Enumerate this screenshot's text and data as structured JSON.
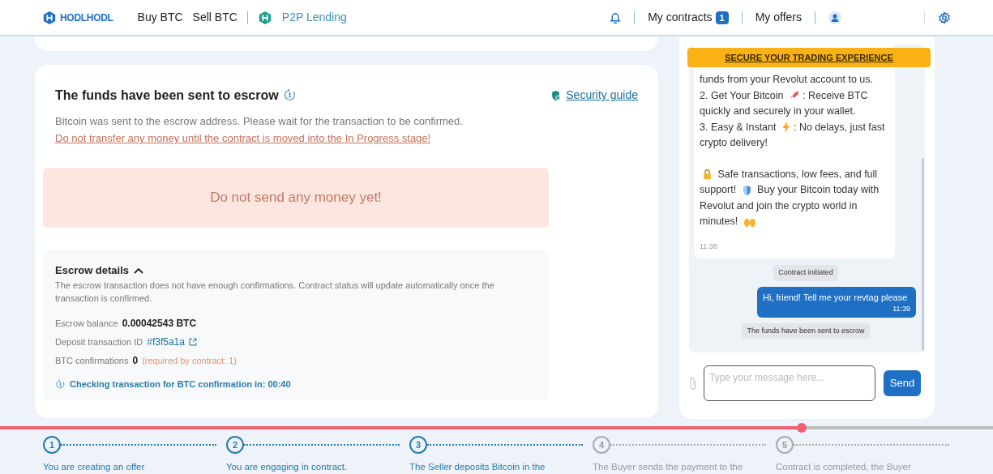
{
  "header": {
    "logo": "HODLHODL",
    "nav": [
      {
        "label": "Buy BTC"
      },
      {
        "label": "Sell BTC"
      }
    ],
    "lending": "P2P Lending",
    "contracts": {
      "label": "My contracts",
      "count": "1"
    },
    "offers": "My offers"
  },
  "status": {
    "title": "The funds have been sent to escrow",
    "guide": "Security guide",
    "text": "Bitcoin was sent to the escrow address. Please wait for the transaction to be confirmed.",
    "warning": "Do not transfer any money until the contract is moved into the In Progress stage!",
    "alert": "Do not send any money yet!"
  },
  "escrow": {
    "title": "Escrow details",
    "expanded": true,
    "note": "The escrow transaction does not have enough confirmations. Contract status will update automatically once the transaction is confirmed.",
    "balance": {
      "label": "Escrow balance",
      "value": "0.00042543 BTC"
    },
    "deposit": {
      "label": "Deposit transaction ID",
      "value": "#f3f5a1a"
    },
    "confirmations": {
      "label": "BTC confirmations",
      "value": "0",
      "required": "(required by contract: 1)"
    },
    "checking": "Checking transaction for BTC confirmation in: 00:40"
  },
  "chat": {
    "banner": "SECURE YOUR TRADING EXPERIENCE",
    "message": {
      "paragraphs": [
        [
          {
            "kind": "text",
            "text": "funds from your Revolut account to us."
          }
        ],
        [
          {
            "kind": "text",
            "text": "2. Get Your Bitcoin "
          },
          {
            "kind": "emoji"
          },
          {
            "kind": "text",
            "text": ": Receive BTC quickly and securely in your wallet."
          }
        ],
        [
          {
            "kind": "text",
            "text": "3. Easy & Instant "
          },
          {
            "kind": "emoji"
          },
          {
            "kind": "text",
            "text": ": No delays, just fast crypto delivery!"
          }
        ],
        [
          {
            "kind": "emoji"
          },
          {
            "kind": "text",
            "text": " Safe transactions, low fees, and full support! "
          },
          {
            "kind": "emoji"
          },
          {
            "kind": "text",
            "text": " Buy your Bitcoin today with Revolut and join the crypto world in minutes! "
          },
          {
            "kind": "emoji"
          }
        ]
      ],
      "time": "11:38"
    },
    "items": [
      {
        "kind": "system",
        "text": "Contract initiated"
      },
      {
        "kind": "outgoing",
        "text": "Hi, friend! Tell me your revtag please",
        "time": "11:39"
      },
      {
        "kind": "system",
        "text": "The funds have been sent to escrow"
      }
    ],
    "input": {
      "placeholder": "Type your message here..."
    },
    "send": "Send"
  },
  "playback": {
    "level": 0.807
  },
  "steps": [
    {
      "number": "1",
      "text": "You are creating an offer",
      "done": true
    },
    {
      "number": "2",
      "text": "You are engaging in contract.",
      "done": true
    },
    {
      "number": "3",
      "text": "The Seller deposits Bitcoin in the",
      "done": true
    },
    {
      "number": "4",
      "text": "The Buyer sends the payment to the",
      "done": false
    },
    {
      "number": "5",
      "text": "Contract is completed, the Buyer",
      "done": false
    }
  ]
}
